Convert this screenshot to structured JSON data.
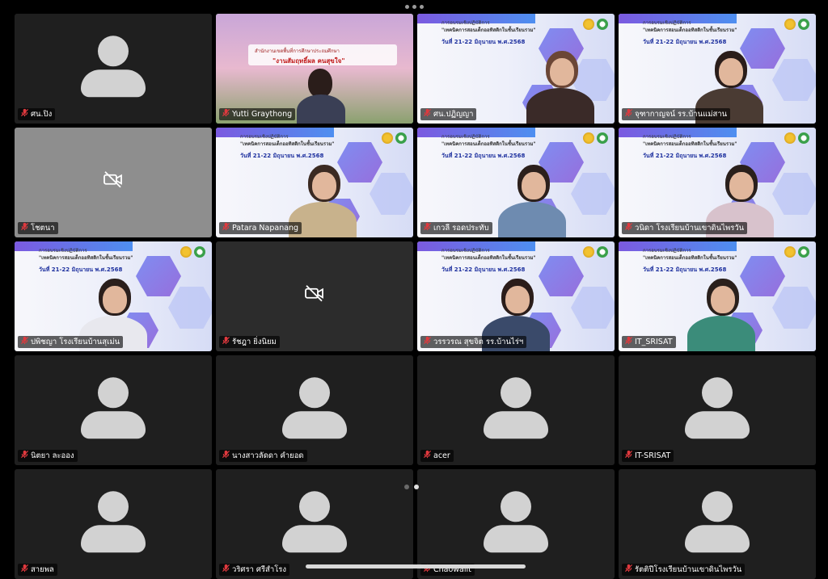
{
  "participants": [
    {
      "name": "ศน.ปิง",
      "view": "avatar"
    },
    {
      "name": "Yutti Graythong",
      "view": "stage",
      "active": true,
      "banner_line1": "สำนักงานเขตพื้นที่การศึกษาประถมศึกษา",
      "banner_line2": "\"งานสัมฤทธิ์ผล คนสุขใจ\""
    },
    {
      "name": "ศน.ปฏิญญา",
      "view": "slide"
    },
    {
      "name": "จุฑากาญจน์ รร.บ้านแม่สาน",
      "view": "slide"
    },
    {
      "name": "โชตนา",
      "view": "camoff",
      "bg": "grey"
    },
    {
      "name": "Patara Napanang",
      "view": "slide"
    },
    {
      "name": "เกวลี รอดประทับ",
      "view": "slide"
    },
    {
      "name": "วนิดา โรงเรียนบ้านเขาดินไพรวัน",
      "view": "slide"
    },
    {
      "name": "ปพิชญา โรงเรียนบ้านสุเม่น",
      "view": "slide"
    },
    {
      "name": "รัชฎา ยิ่งนิยม",
      "view": "camoff",
      "bg": "dark"
    },
    {
      "name": "วรรวรณ สุขจิต รร.บ้านไร่ฯ",
      "view": "slide"
    },
    {
      "name": "IT_SRISAT",
      "view": "slide"
    },
    {
      "name": "นิตยา ละออง",
      "view": "avatar"
    },
    {
      "name": "นางสาวลัดดา คำยอด",
      "view": "avatar"
    },
    {
      "name": "acer",
      "view": "avatar"
    },
    {
      "name": "IT-SRISAT",
      "view": "avatar"
    },
    {
      "name": "สายพล",
      "view": "avatar"
    },
    {
      "name": "วริศรา ศรีสำโรง",
      "view": "avatar"
    },
    {
      "name": "Chaowalit",
      "view": "avatar"
    },
    {
      "name": "รัตติปีโรงเรียนบ้านเขาดินไพรวัน",
      "view": "avatar"
    }
  ],
  "slide": {
    "line1": "การอบรมเชิงปฏิบัติการ",
    "line2": "\"เทคนิคการสอนเด็กออทิสติกในชั้นเรียนรวม\"",
    "date": "วันที่ 21-22 มิถุนายน พ.ศ.2568"
  },
  "icons": {
    "mic": "mic-muted-icon",
    "camera": "camera-off-icon",
    "avatar": "avatar-placeholder-icon"
  },
  "colors": {
    "active_speaker": "#27c43c",
    "muted_mic": "#e0393e",
    "background": "#000000"
  }
}
